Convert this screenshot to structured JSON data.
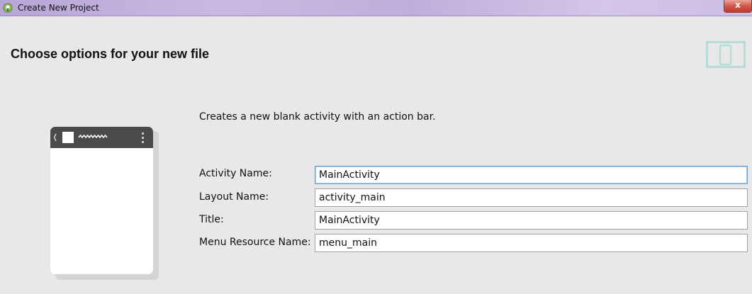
{
  "window": {
    "title": "Create New Project",
    "close_glyph": "x"
  },
  "header": {
    "title": "Choose options for your new file",
    "icon": "device-phone-icon"
  },
  "main": {
    "description": "Creates a new blank activity with an action bar.",
    "fields": [
      {
        "label": "Activity Name:",
        "value": "MainActivity",
        "focused": true
      },
      {
        "label": "Layout Name:",
        "value": "activity_main",
        "focused": false
      },
      {
        "label": "Title:",
        "value": "MainActivity",
        "focused": false
      },
      {
        "label": "Menu Resource Name:",
        "value": "menu_main",
        "focused": false
      }
    ]
  },
  "colors": {
    "titlebar": "#c9b9e2",
    "background": "#e8e8e8",
    "focus_border": "#6f9fd6",
    "phone_bar": "#4a4a4a",
    "device_icon": "#b6dcd9"
  }
}
